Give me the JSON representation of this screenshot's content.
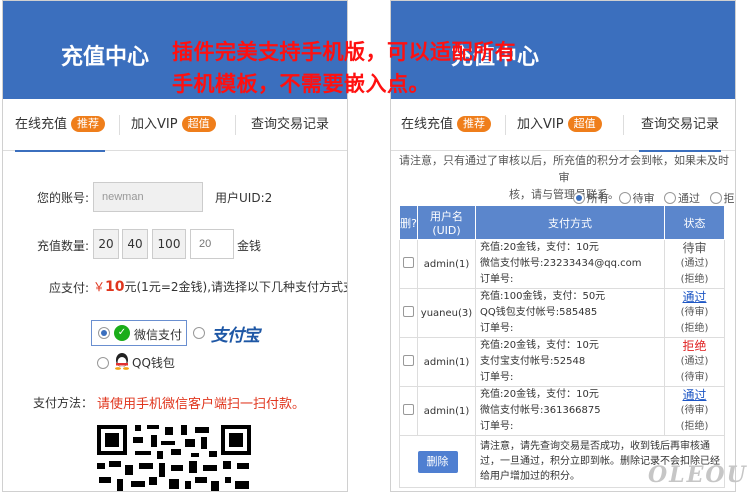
{
  "promo": {
    "line1": "插件完美支持手机版，可以适配所有",
    "line2": "手机模板，不需要嵌入点。"
  },
  "left": {
    "header_title": "充值中心",
    "tabs": [
      {
        "label": "在线充值",
        "badge": "推荐"
      },
      {
        "label": "加入VIP",
        "badge": "超值"
      },
      {
        "label": "查询交易记录"
      }
    ],
    "account_label": "您的账号:",
    "account_value": "newman",
    "uid_text": "用户UID:2",
    "amount_label": "充值数量:",
    "amounts": [
      "20",
      "40",
      "100"
    ],
    "amount_input_placeholder": "20",
    "amount_unit": "金钱",
    "due_label": "应支付:",
    "due_currency": "￥",
    "due_amount": "10",
    "due_rest": "元(1元=2金钱),请选择以下几种支付方式支付:",
    "pay_options": [
      {
        "label": "微信支付",
        "icon": "wechat-icon",
        "selected": true
      },
      {
        "label": "支付宝",
        "icon": "alipay-logo",
        "selected": false
      },
      {
        "label": "QQ钱包",
        "icon": "qq-icon",
        "selected": false
      }
    ],
    "method_label": "支付方法：",
    "method_text": "请使用手机微信客户端扫一扫付款。"
  },
  "right": {
    "header_title": "充值中心",
    "tabs": [
      {
        "label": "在线充值",
        "badge": "推荐"
      },
      {
        "label": "加入VIP",
        "badge": "超值"
      },
      {
        "label": "查询交易记录"
      }
    ],
    "notice_line1": "请注意，只有通过了审核以后，所充值的积分才会到帐，如果未及时审",
    "notice_line2": "核，请与管理员联系。",
    "filters": [
      "所有",
      "待审",
      "通过",
      "拒绝"
    ],
    "table_headers": {
      "select": "删?",
      "user": "用户名(UID)",
      "method": "支付方式",
      "status": "状态"
    },
    "records": [
      {
        "user": "admin(1)",
        "line1": "充值:20金钱，支付：10元",
        "line2": "微信支付帐号:23233434@qq.com",
        "line3": "订单号:",
        "status": "待审",
        "status_type": "pending",
        "sub1": "(通过)",
        "sub2": "(拒绝)"
      },
      {
        "user": "yuaneu(3)",
        "line1": "充值:100金钱，支付：50元",
        "line2": "QQ钱包支付帐号:585485",
        "line3": "订单号:",
        "status": "通过",
        "status_type": "pass",
        "sub1": "(待审)",
        "sub2": "(拒绝)"
      },
      {
        "user": "admin(1)",
        "line1": "充值:20金钱，支付：10元",
        "line2": "支付宝支付帐号:52548",
        "line3": "订单号:",
        "status": "拒绝",
        "status_type": "reject",
        "sub1": "(通过)",
        "sub2": "(待审)"
      },
      {
        "user": "admin(1)",
        "line1": "充值:20金钱，支付：10元",
        "line2": "微信支付帐号:361366875",
        "line3": "订单号:",
        "status": "通过",
        "status_type": "pass",
        "sub1": "(待审)",
        "sub2": "(拒绝)"
      }
    ],
    "delete_button": "删除",
    "footer_note": "请注意，请先查询交易是否成功，收到钱后再审核通过，一旦通过，积分立即到帐。删除记录不会扣除已经给用户增加过的积分。"
  },
  "watermark": "OLEOU",
  "colors": {
    "header": "#3b6fbe",
    "badge": "#ef7e1b",
    "promo": "#ff1010",
    "table_head": "#5b86cc"
  }
}
